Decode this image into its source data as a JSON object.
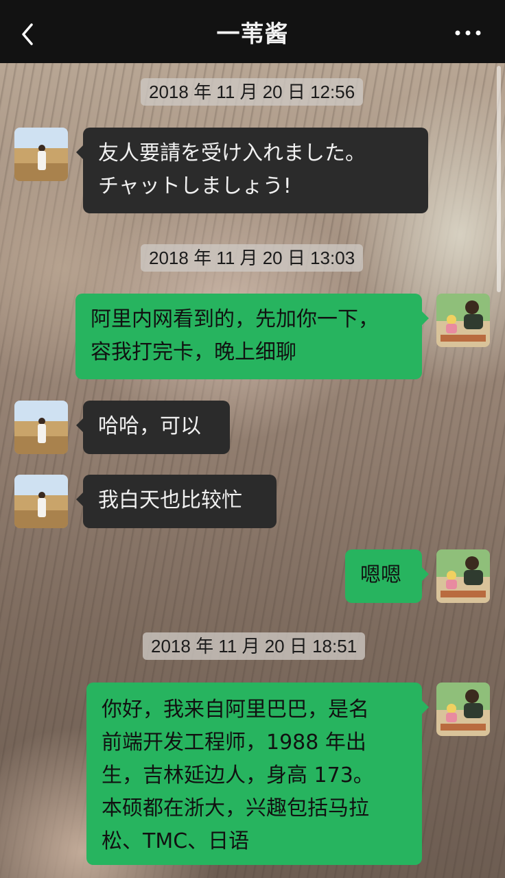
{
  "header": {
    "title": "一苇酱",
    "back_icon": "chevron-left-icon",
    "more_icon": "more-dots-icon"
  },
  "timestamps": [
    "2018 年 11 月 20 日 12:56",
    "2018 年 11 月 20 日 13:03",
    "2018 年 11 月 20 日 18:51"
  ],
  "messages": [
    {
      "side": "left",
      "lines": [
        "友人要請を受け入れました。",
        "チャットしましょう!"
      ]
    },
    {
      "side": "right",
      "lines": [
        "阿里内网看到的，先加你一下，",
        "容我打完卡，晚上细聊"
      ]
    },
    {
      "side": "left",
      "lines": [
        "哈哈，可以"
      ]
    },
    {
      "side": "left",
      "lines": [
        "我白天也比较忙"
      ]
    },
    {
      "side": "right",
      "lines": [
        "嗯嗯"
      ]
    },
    {
      "side": "right",
      "lines": [
        "你好，我来自阿里巴巴，是名",
        "前端开发工程师，1988 年出",
        "生，吉林延边人，身高 173。",
        "本硕都在浙大，兴趣包括马拉",
        "松、TMC、日语"
      ]
    }
  ],
  "colors": {
    "navbar": "#121212",
    "bubble_left": "#2b2b2b",
    "bubble_right": "#27b45f",
    "timestamp_bg": "#cdc8c3"
  }
}
